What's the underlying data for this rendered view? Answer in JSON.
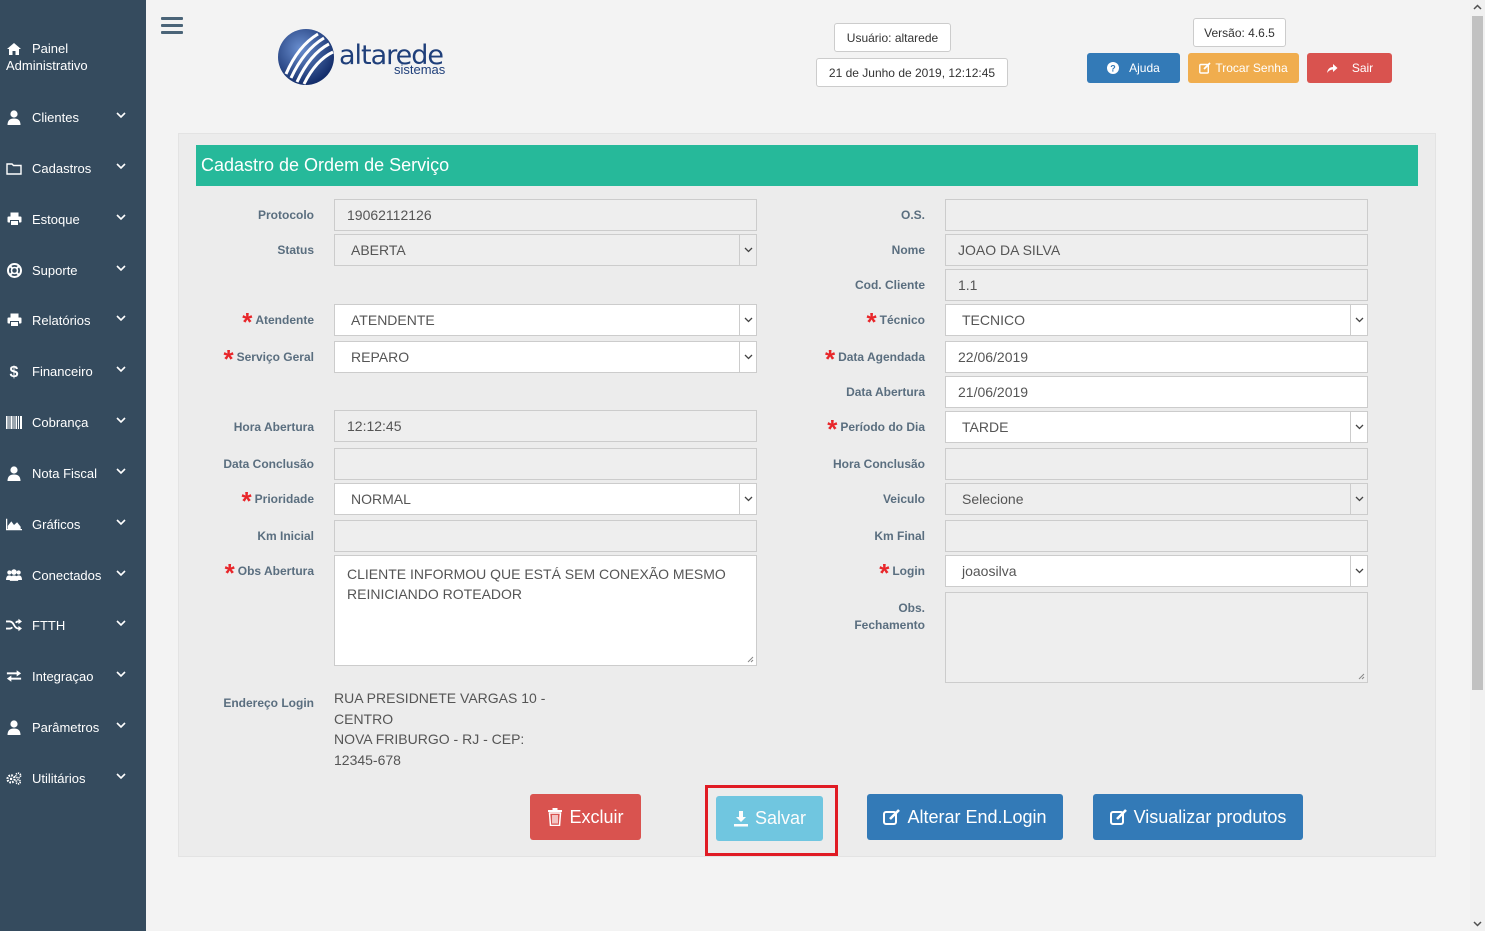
{
  "sidebar": {
    "painel": {
      "line1": "Painel",
      "line2": "Administrativo",
      "icon": "home-icon"
    },
    "items": [
      {
        "label": "Clientes",
        "icon": "user-icon"
      },
      {
        "label": "Cadastros",
        "icon": "folder-icon"
      },
      {
        "label": "Estoque",
        "icon": "print-icon"
      },
      {
        "label": "Suporte",
        "icon": "lifebuoy-icon"
      },
      {
        "label": "Relatórios",
        "icon": "print-icon"
      },
      {
        "label": "Financeiro",
        "icon": "dollar-icon"
      },
      {
        "label": "Cobrança",
        "icon": "barcode-icon"
      },
      {
        "label": "Nota Fiscal",
        "icon": "user-icon"
      },
      {
        "label": "Gráficos",
        "icon": "area-chart-icon"
      },
      {
        "label": "Conectados",
        "icon": "users-icon"
      },
      {
        "label": "FTTH",
        "icon": "random-icon"
      },
      {
        "label": "Integraçao",
        "icon": "exchange-icon"
      },
      {
        "label": "Parâmetros",
        "icon": "user-icon"
      },
      {
        "label": "Utilitários",
        "icon": "cogs-icon"
      }
    ]
  },
  "header": {
    "logo_text": "altarede",
    "logo_sub": "sistemas",
    "user": "Usuário: altarede",
    "datetime": "21 de Junho de 2019, 12:12:45",
    "version": "Versão: 4.6.5",
    "help_label": "Ajuda",
    "change_password_label": "Trocar Senha",
    "logout_label": "Sair"
  },
  "form": {
    "title": "Cadastro de Ordem de Serviço",
    "left": {
      "protocolo": {
        "label": "Protocolo",
        "value": "19062112126"
      },
      "status": {
        "label": "Status",
        "value": "ABERTA"
      },
      "atendente": {
        "label": "Atendente",
        "value": "ATENDENTE"
      },
      "servico_geral": {
        "label": "Serviço Geral",
        "value": "REPARO"
      },
      "hora_abertura": {
        "label": "Hora Abertura",
        "value": "12:12:45"
      },
      "data_conclusao": {
        "label": "Data Conclusão",
        "value": ""
      },
      "prioridade": {
        "label": "Prioridade",
        "value": "NORMAL"
      },
      "km_inicial": {
        "label": "Km Inicial",
        "value": ""
      },
      "obs_abertura": {
        "label": "Obs Abertura",
        "value": "CLIENTE INFORMOU QUE ESTÁ SEM CONEXÃO MESMO REINICIANDO ROTEADOR"
      },
      "endereco_login": {
        "label": "Endereço Login",
        "line1": "RUA PRESIDNETE VARGAS 10 -",
        "line2": "CENTRO",
        "line3": "NOVA FRIBURGO - RJ - CEP:",
        "line4": "12345-678"
      }
    },
    "right": {
      "os": {
        "label": "O.S.",
        "value": ""
      },
      "nome": {
        "label": "Nome",
        "value": "JOAO DA SILVA"
      },
      "cod_cliente": {
        "label": "Cod. Cliente",
        "value": "1.1"
      },
      "tecnico": {
        "label": "Técnico",
        "value": "TECNICO"
      },
      "data_agendada": {
        "label": "Data Agendada",
        "value": "22/06/2019"
      },
      "data_abertura": {
        "label": "Data Abertura",
        "value": "21/06/2019"
      },
      "periodo_dia": {
        "label": "Período do Dia",
        "value": "TARDE"
      },
      "hora_conclusao": {
        "label": "Hora Conclusão",
        "value": ""
      },
      "veiculo": {
        "label": "Veiculo",
        "value": "Selecione"
      },
      "km_final": {
        "label": "Km Final",
        "value": ""
      },
      "login": {
        "label": "Login",
        "value": "joaosilva"
      },
      "obs_fechamento": {
        "label_line1": "Obs.",
        "label_line2": "Fechamento",
        "value": ""
      }
    },
    "buttons": {
      "excluir": "Excluir",
      "salvar": "Salvar",
      "alterar_end_login": "Alterar End.Login",
      "visualizar_produtos": "Visualizar produtos"
    }
  },
  "colors": {
    "sidebar_bg": "#354b5e",
    "title_bar": "#26b99a",
    "help_button": "#337ab7",
    "change_password_button": "#f0ad4e",
    "logout_button": "#d9534f",
    "save_button": "#5bc0de",
    "highlight": "#e01b24"
  }
}
